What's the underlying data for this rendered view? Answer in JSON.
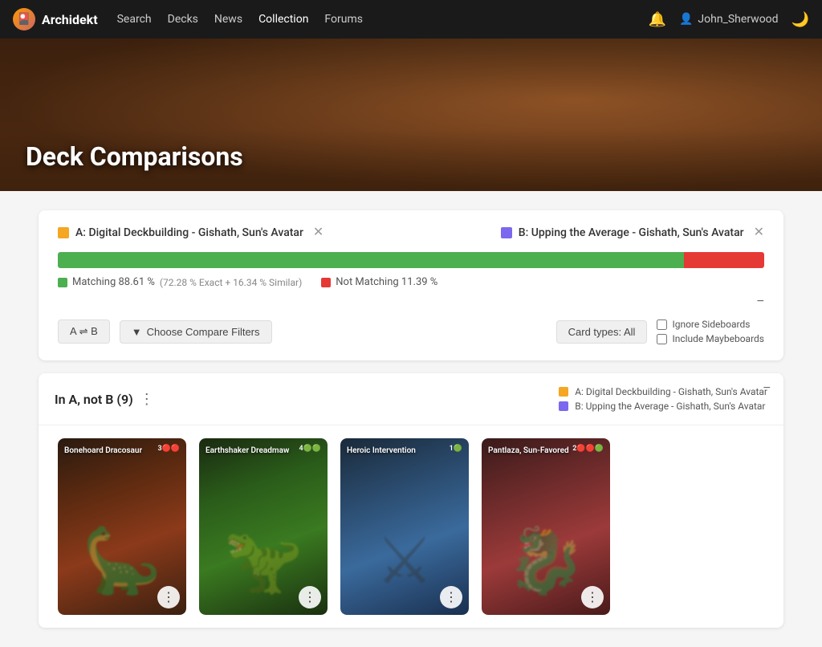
{
  "nav": {
    "logo_text": "Archidekt",
    "links": [
      "Search",
      "Decks",
      "News",
      "Collection",
      "Forums"
    ],
    "active_link": "Collection",
    "user_name": "John_Sherwood"
  },
  "hero": {
    "title": "Deck Comparisons"
  },
  "comparison": {
    "deck_a_label": "A: Digital Deckbuilding - Gishath, Sun's Avatar",
    "deck_b_label": "B: Upping the Average - Gishath, Sun's Avatar",
    "matching_pct": "Matching 88.61 %",
    "matching_exact": "72.28 % Exact",
    "matching_similar": "16.34 % Similar",
    "not_matching_pct": "Not Matching 11.39 %",
    "progress_matching_width": "88.61",
    "progress_not_matching_width": "11.39",
    "filter_swap_label": "A ⇌ B",
    "filter_choose_label": "Choose Compare Filters",
    "card_types_label": "Card types: All",
    "ignore_sideboards": "Ignore Sideboards",
    "include_maybeboards": "Include Maybeboards",
    "collapse_symbol": "−"
  },
  "section": {
    "title": "In A, not B (9)",
    "legend_a": "A: Digital Deckbuilding - Gishath, Sun's Avatar",
    "legend_b": "B: Upping the Average - Gishath, Sun's Avatar",
    "collapse_symbol": "−"
  },
  "cards": [
    {
      "name": "Bonehoard Dracosaur",
      "cost": "3🔴🔴",
      "style_class": "card-1",
      "art_char": "🦕"
    },
    {
      "name": "Earthshaker Dreadmaw",
      "cost": "4🟢🟢",
      "style_class": "card-2",
      "art_char": "🦖"
    },
    {
      "name": "Heroic Intervention",
      "cost": "1🟢",
      "style_class": "card-3",
      "art_char": "⚔"
    },
    {
      "name": "Pantlaza, Sun-Favored",
      "cost": "2🔴🔴🟢",
      "style_class": "card-4",
      "art_char": "🐉"
    }
  ],
  "colors": {
    "deck_a_color": "#f5a623",
    "deck_b_color": "#7b68ee",
    "matching_color": "#4caf50",
    "not_matching_color": "#e53935"
  }
}
